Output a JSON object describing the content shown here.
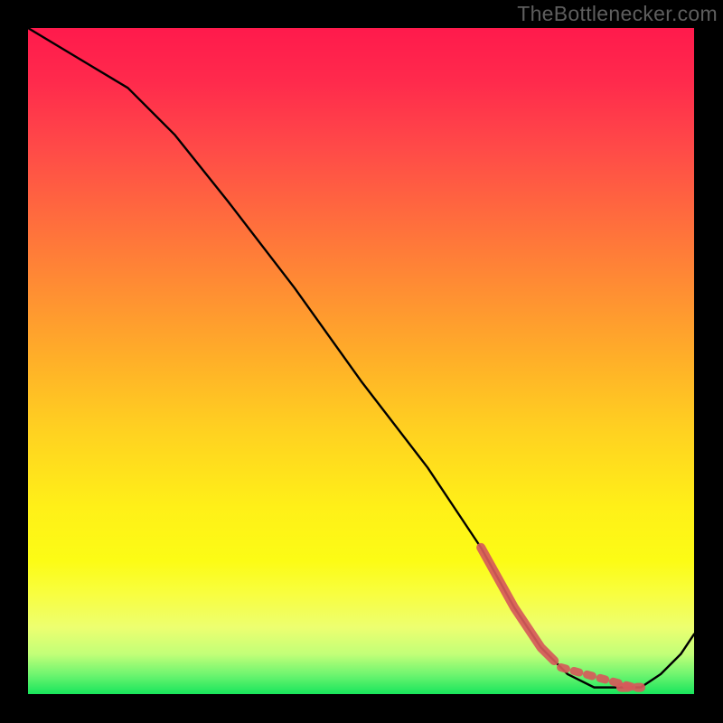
{
  "watermark": "TheBottlenecker.com",
  "chart_data": {
    "type": "line",
    "title": "",
    "xlabel": "",
    "ylabel": "",
    "xlim": [
      0,
      100
    ],
    "ylim": [
      0,
      100
    ],
    "note": "No axis ticks or numeric labels are visible; x/y are in percent of plot area, y measured from bottom. Values estimated from pixel position.",
    "series": [
      {
        "name": "curve",
        "x": [
          0,
          5,
          10,
          15,
          22,
          30,
          40,
          50,
          60,
          68,
          73,
          77,
          81,
          85,
          88,
          92,
          95,
          98,
          100
        ],
        "y": [
          100,
          97,
          94,
          91,
          84,
          74,
          61,
          47,
          34,
          22,
          13,
          7,
          3,
          1,
          1,
          1,
          3,
          6,
          9
        ]
      }
    ],
    "highlight_segments": {
      "note": "Two thicker red-tinted segments overlaid on the curve near the trough.",
      "segments": [
        {
          "x_pct_range": [
            68,
            79
          ],
          "desc": "left-thick-segment"
        },
        {
          "x_pct_range": [
            89,
            92
          ],
          "desc": "right-thick-dot"
        }
      ]
    },
    "background": {
      "type": "vertical-gradient",
      "stops": [
        {
          "pos": 0.0,
          "color": "#ff1a4c"
        },
        {
          "pos": 0.5,
          "color": "#ffb028"
        },
        {
          "pos": 0.82,
          "color": "#fcfc15"
        },
        {
          "pos": 0.97,
          "color": "#70f570"
        },
        {
          "pos": 1.0,
          "color": "#18e55c"
        }
      ]
    }
  }
}
